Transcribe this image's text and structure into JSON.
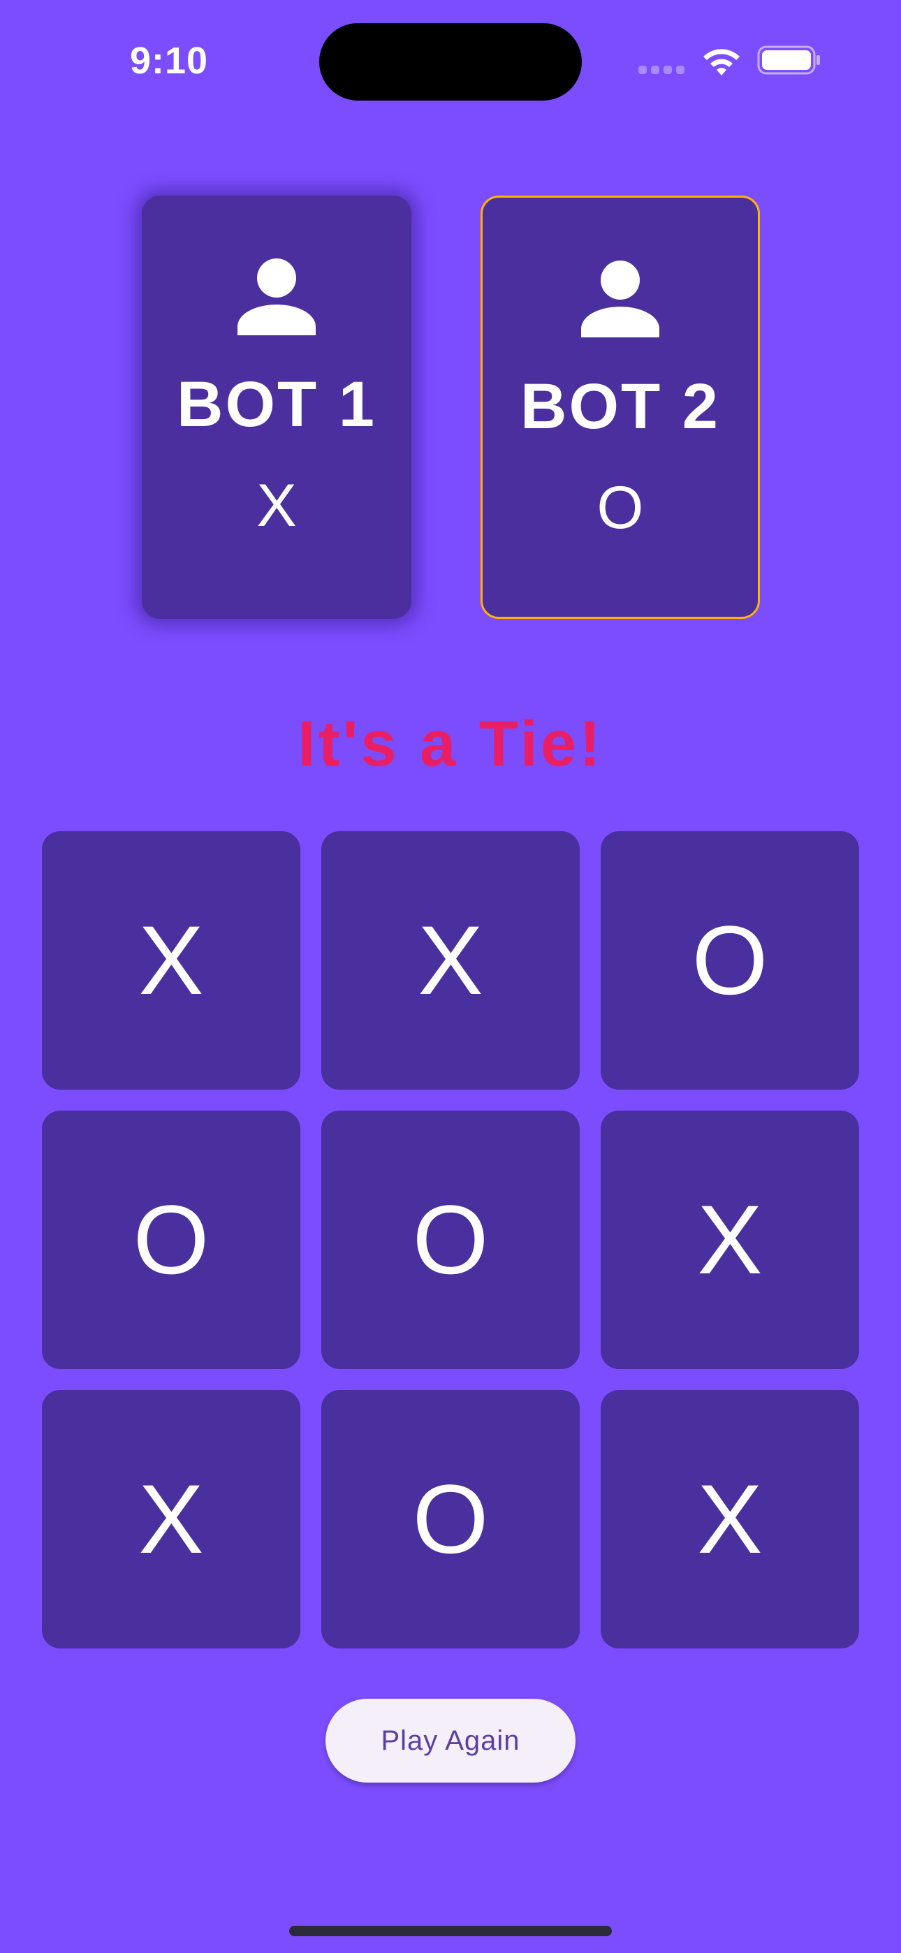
{
  "status_bar": {
    "time": "9:10"
  },
  "players": [
    {
      "name": "BOT 1",
      "symbol": "X",
      "icon": "person-icon",
      "active": false
    },
    {
      "name": "BOT 2",
      "symbol": "O",
      "icon": "person-icon",
      "active": true
    }
  ],
  "result": {
    "message": "It's a Tie!"
  },
  "board": {
    "cells": [
      "X",
      "X",
      "O",
      "O",
      "O",
      "X",
      "X",
      "O",
      "X"
    ]
  },
  "actions": {
    "play_again_label": "Play Again"
  },
  "colors": {
    "background": "#7c4dff",
    "card": "#4a2f9e",
    "active_border": "#ffb300",
    "result_text": "#e91e63",
    "button_bg": "#f5effa",
    "button_text": "#5b3fa3"
  }
}
